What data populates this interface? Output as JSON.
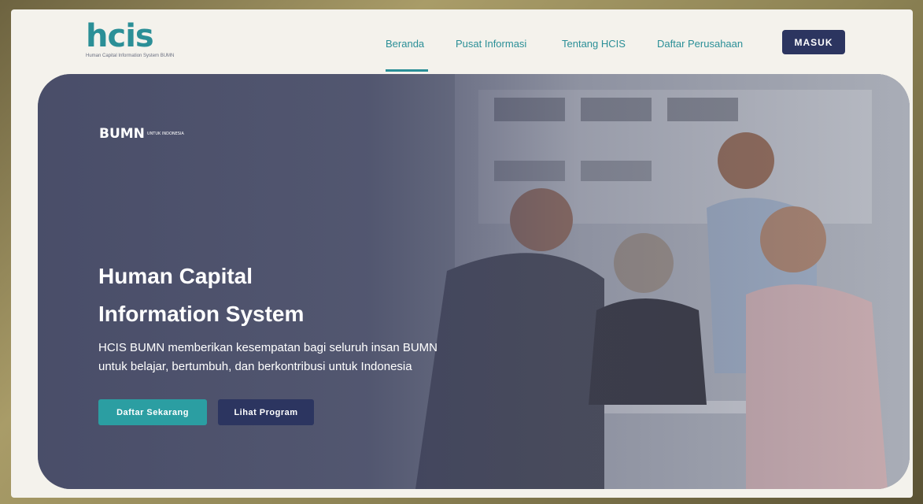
{
  "header": {
    "logo_text": "hcis",
    "logo_tagline": "Human Capital Information System BUMN",
    "nav": [
      {
        "label": "Beranda",
        "active": true
      },
      {
        "label": "Pusat Informasi",
        "active": false
      },
      {
        "label": "Tentang HCIS",
        "active": false
      },
      {
        "label": "Daftar Perusahaan",
        "active": false
      }
    ],
    "login_label": "MASUK"
  },
  "hero": {
    "brand_logo": "BUMN",
    "brand_tagline": "UNTUK INDONESIA",
    "title_line1": "Human Capital",
    "title_line2": "Information System",
    "description_line1": "HCIS BUMN memberikan kesempatan bagi seluruh insan BUMN",
    "description_line2": "untuk belajar, bertumbuh, dan berkontribusi untuk Indonesia",
    "primary_button": "Daftar Sekarang",
    "secondary_button": "Lihat Program"
  },
  "colors": {
    "accent": "#2b8f97",
    "navy": "#2c3560",
    "primary_button": "#2b9ea2"
  }
}
